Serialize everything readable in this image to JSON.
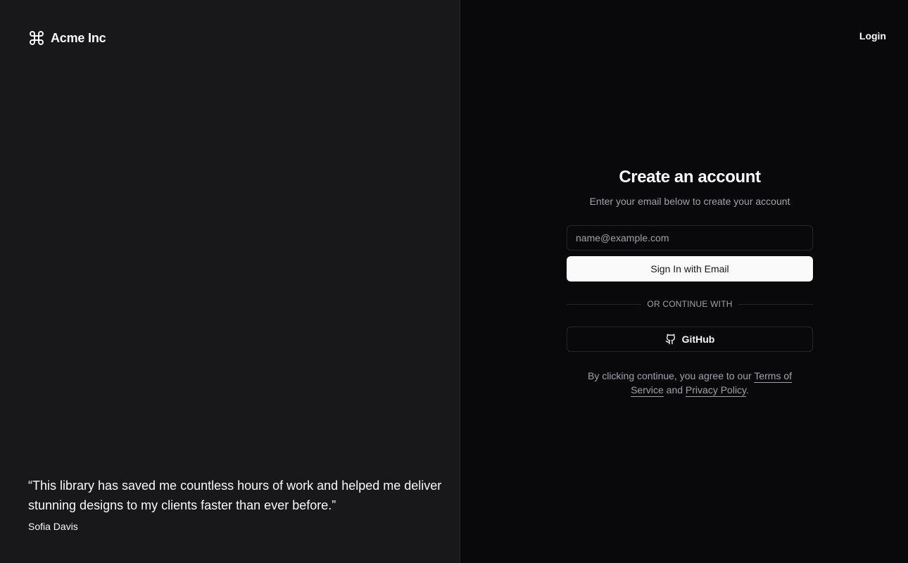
{
  "brand": {
    "name": "Acme Inc",
    "icon": "command-icon"
  },
  "testimonial": {
    "quote": "“This library has saved me countless hours of work and helped me deliver stunning designs to my clients faster than ever before.”",
    "author": "Sofia Davis"
  },
  "header": {
    "login_label": "Login"
  },
  "form": {
    "title": "Create an account",
    "subtitle": "Enter your email below to create your account",
    "email_placeholder": "name@example.com",
    "email_value": "",
    "submit_label": "Sign In with Email",
    "divider_text": "Or continue with",
    "github_label": "GitHub",
    "github_icon": "github-icon"
  },
  "terms": {
    "prefix": "By clicking continue, you agree to our",
    "terms_link": "Terms of Service",
    "conjunction": "and",
    "privacy_link": "Privacy Policy",
    "suffix": "."
  },
  "colors": {
    "left_bg": "#18181b",
    "right_bg": "#09090b",
    "foreground": "#fafafa",
    "muted": "#a1a1aa",
    "border": "#27272a"
  }
}
